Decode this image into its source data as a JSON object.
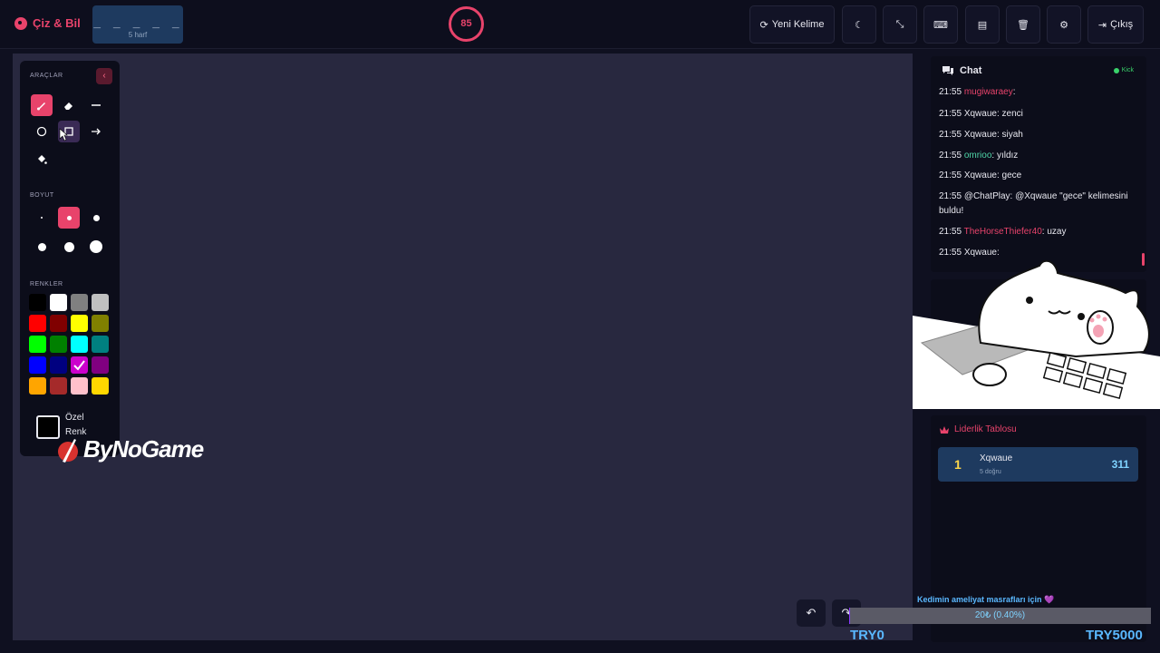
{
  "app": {
    "title": "Çiz & Bil"
  },
  "word": {
    "blanks": "_ _ _ _ _",
    "length_label": "5 harf"
  },
  "timer": {
    "seconds": "85"
  },
  "toolbar": {
    "new_word_label": "Yeni Kelime",
    "exit_label": "Çıkış",
    "icons": [
      "refresh-icon",
      "moon-icon",
      "compress-icon",
      "keyboard-icon",
      "archive-icon",
      "trash-icon",
      "gear-icon",
      "sign-out-icon"
    ]
  },
  "tools": {
    "title": "ARAÇLAR",
    "size_title": "BOYUT",
    "colors_title": "RENKLER",
    "custom_color_label": "Özel Renk",
    "active_tool": "brush",
    "selected_color": "#cc00cc",
    "colors": [
      "#000000",
      "#ffffff",
      "#808080",
      "#c0c0c0",
      "#ff0000",
      "#800000",
      "#ffff00",
      "#808000",
      "#00ff00",
      "#008000",
      "#00ffff",
      "#008080",
      "#0000ff",
      "#000080",
      "#cc00cc",
      "#800080",
      "#ffa500",
      "#a52a2a",
      "#ffc0cb",
      "#ffd700"
    ]
  },
  "watermark": {
    "text": "ByNoGame"
  },
  "chat": {
    "title": "Chat",
    "platform": "Kick",
    "messages": [
      {
        "time": "21:55",
        "user": "mugiwaraey",
        "text": ":",
        "color": "#e8436b"
      },
      {
        "time": "21:55",
        "user": "Xqwaue",
        "text": ": zenci",
        "color": "#e8e8f0"
      },
      {
        "time": "21:55",
        "user": "Xqwaue",
        "text": ": siyah",
        "color": "#e8e8f0"
      },
      {
        "time": "21:55",
        "user": "omrioo",
        "text": ": yıldız",
        "color": "#4fd6a8"
      },
      {
        "time": "21:55",
        "user": "Xqwaue",
        "text": ": gece",
        "color": "#e8e8f0"
      },
      {
        "time": "21:55",
        "user": "@ChatPlay",
        "text": ": @Xqwaue \"gece\" kelimesini buldu!",
        "color": "#e8e8f0"
      },
      {
        "time": "21:55",
        "user": "TheHorseThiefer40",
        "text": ": uzay",
        "color": "#e8436b"
      },
      {
        "time": "21:55",
        "user": "Xqwaue",
        "text": ":",
        "color": "#e8e8f0"
      }
    ]
  },
  "leaderboard": {
    "title": "Liderlik Tablosu",
    "entries": [
      {
        "rank": "1",
        "name": "Xqwaue",
        "sub": "5 doğru",
        "score": "311"
      }
    ]
  },
  "donation": {
    "message": "Kedimin ameliyat masrafları için 💜",
    "amount": "20₺ (0.40%)",
    "progress": 0.004,
    "min_label": "TRY0",
    "max_label": "TRY5000"
  }
}
